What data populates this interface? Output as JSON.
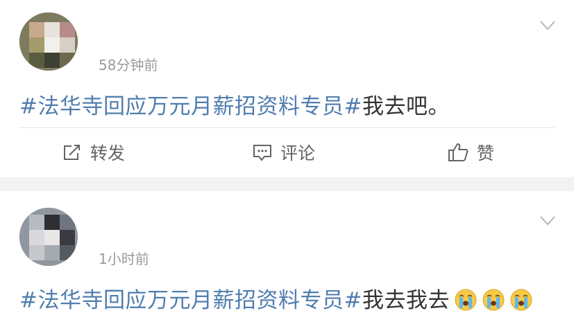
{
  "posts": [
    {
      "time": "58分钟前",
      "hashtag": "#法华寺回应万元月薪招资料专员#",
      "body": "我去吧。"
    },
    {
      "time": "1小时前",
      "hashtag": "#法华寺回应万元月薪招资料专员#",
      "body": "我去我去",
      "emojis": [
        "crying-face-icon",
        "crying-face-icon",
        "crying-face-icon"
      ]
    }
  ],
  "actions": {
    "repost": "转发",
    "comment": "评论",
    "like": "赞"
  },
  "colors": {
    "hashtag": "#507daf",
    "text": "#333333",
    "meta": "#9a9a9a",
    "separator": "#f2f2f2"
  }
}
